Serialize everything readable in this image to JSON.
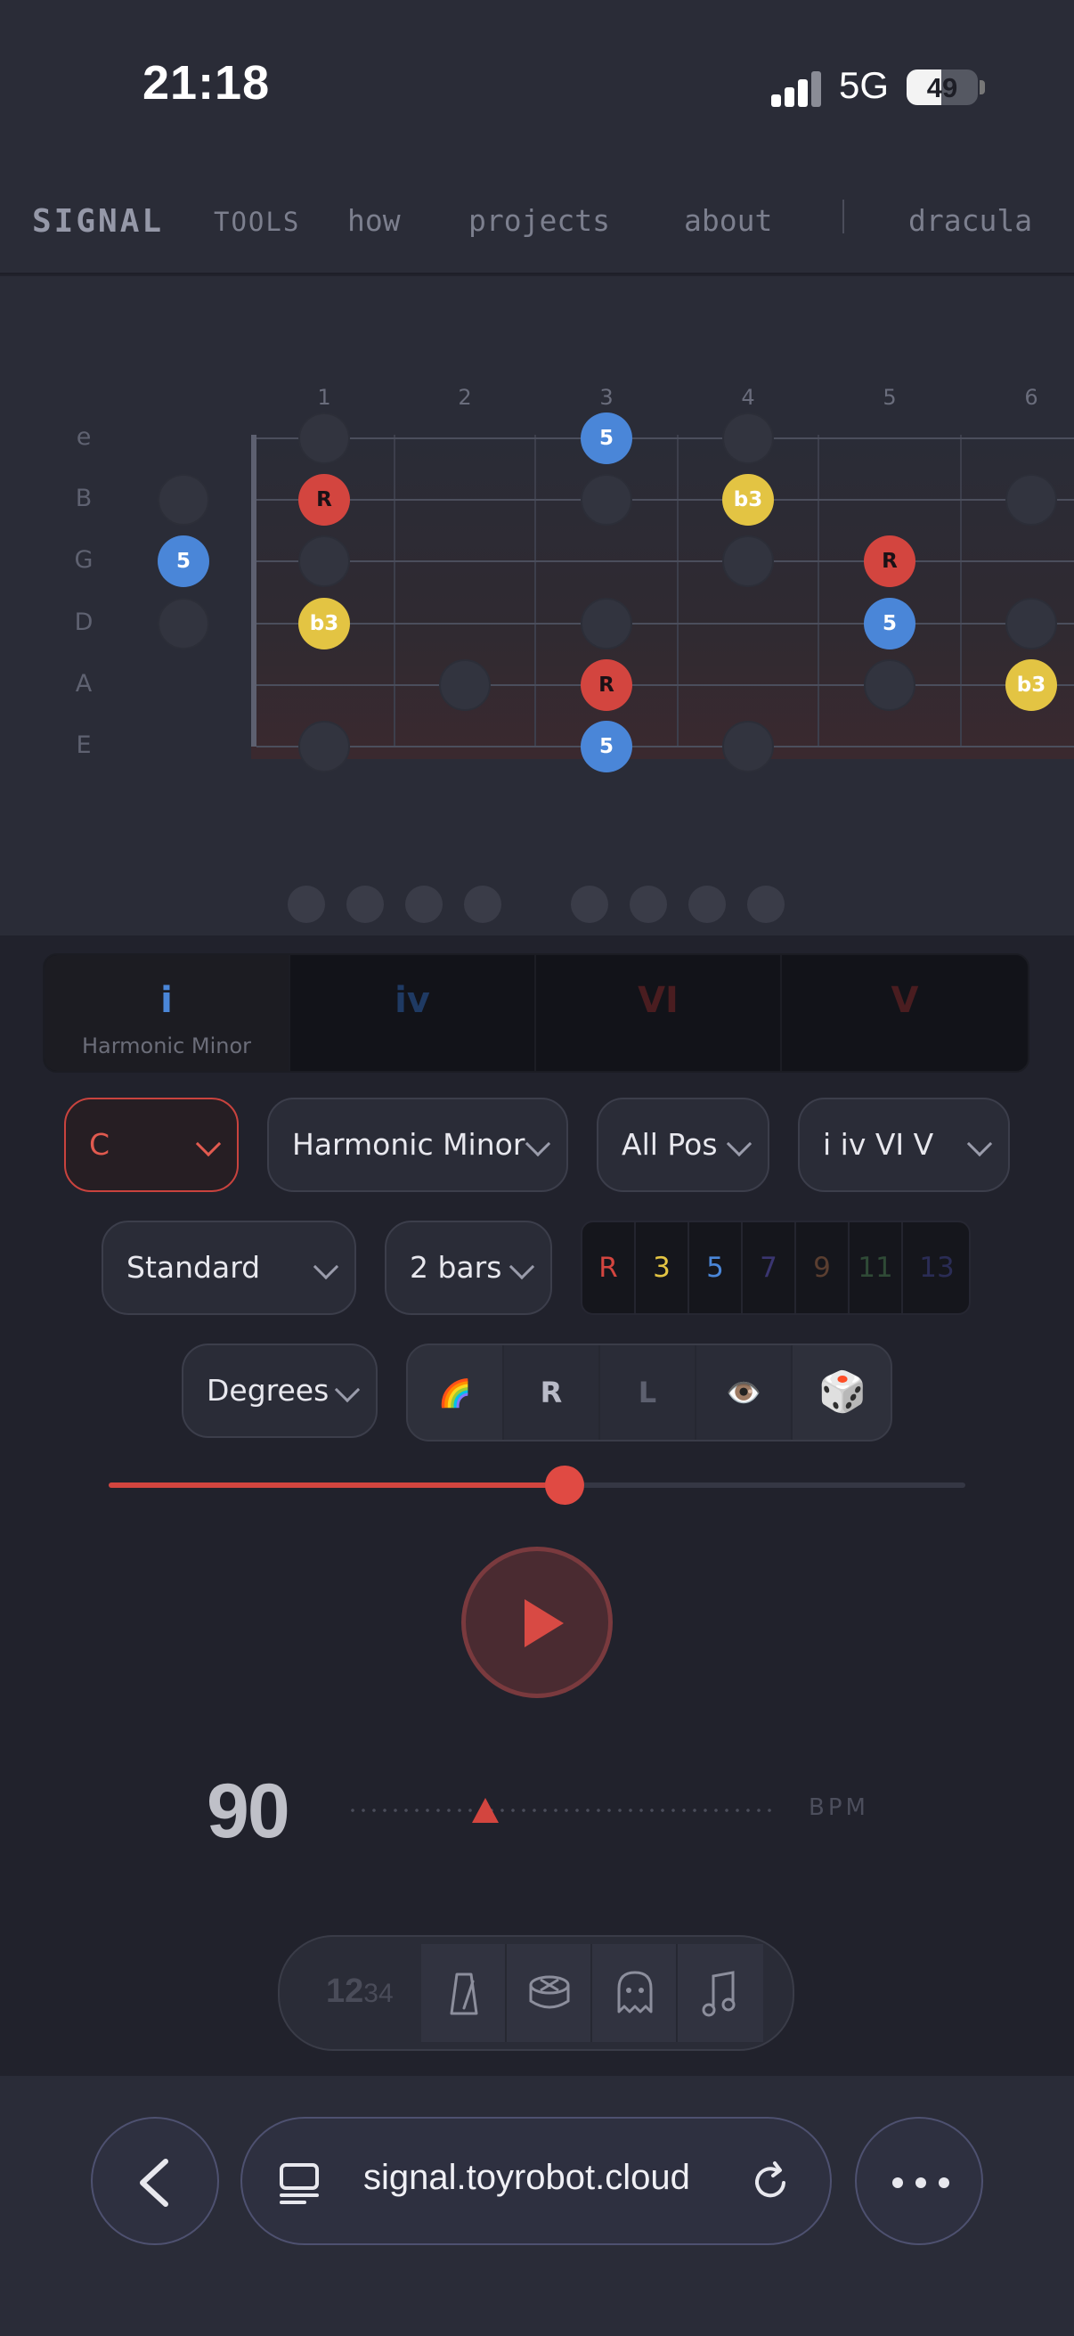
{
  "status_bar": {
    "time": "21:18",
    "network": "5G",
    "battery": "49",
    "battery_level": 0.49
  },
  "nav": {
    "brand": "SIGNAL",
    "tools": "TOOLS",
    "links": [
      "how",
      "projects",
      "about"
    ],
    "theme": "dracula"
  },
  "fretboard": {
    "fret_numbers": [
      "1",
      "2",
      "3",
      "4",
      "5",
      "6"
    ],
    "strings": [
      "e",
      "B",
      "G",
      "D",
      "A",
      "E"
    ],
    "notes": [
      {
        "string": 0,
        "fret": 3,
        "label": "5",
        "color": "blue"
      },
      {
        "string": 1,
        "fret": 1,
        "label": "R",
        "color": "red"
      },
      {
        "string": 1,
        "fret": 4,
        "label": "b3",
        "color": "yellow"
      },
      {
        "string": 2,
        "fret": 0,
        "label": "5",
        "color": "blue"
      },
      {
        "string": 2,
        "fret": 5,
        "label": "R",
        "color": "red"
      },
      {
        "string": 3,
        "fret": 1,
        "label": "b3",
        "color": "yellow"
      },
      {
        "string": 3,
        "fret": 5,
        "label": "5",
        "color": "blue"
      },
      {
        "string": 4,
        "fret": 3,
        "label": "R",
        "color": "red"
      },
      {
        "string": 4,
        "fret": 6,
        "label": "b3",
        "color": "yellow"
      },
      {
        "string": 5,
        "fret": 3,
        "label": "5",
        "color": "blue"
      }
    ],
    "empty_markers": [
      {
        "string": 0,
        "fret": 1
      },
      {
        "string": 0,
        "fret": 4
      },
      {
        "string": 1,
        "fret": 0
      },
      {
        "string": 1,
        "fret": 3
      },
      {
        "string": 1,
        "fret": 6
      },
      {
        "string": 2,
        "fret": 1
      },
      {
        "string": 2,
        "fret": 4
      },
      {
        "string": 3,
        "fret": 0
      },
      {
        "string": 3,
        "fret": 3
      },
      {
        "string": 3,
        "fret": 6
      },
      {
        "string": 4,
        "fret": 2
      },
      {
        "string": 4,
        "fret": 5
      },
      {
        "string": 5,
        "fret": 1
      },
      {
        "string": 5,
        "fret": 4
      }
    ],
    "page_count": 8
  },
  "progression": {
    "chords": [
      {
        "degree": "i",
        "name": "Harmonic Minor",
        "color": "#4a86d8",
        "active": true
      },
      {
        "degree": "iv",
        "name": "",
        "color": "#1f3a63",
        "active": false
      },
      {
        "degree": "VI",
        "name": "",
        "color": "#4a1d20",
        "active": false
      },
      {
        "degree": "V",
        "name": "",
        "color": "#4a1d20",
        "active": false
      }
    ]
  },
  "selects": {
    "key": "C",
    "scale": "Harmonic Minor",
    "position": "All Pos",
    "progression": "i iv VI V",
    "tuning": "Standard",
    "length": "2 bars",
    "labels": "Degrees"
  },
  "intervals": [
    {
      "label": "R",
      "color": "#d3453f"
    },
    {
      "label": "3",
      "color": "#e3c443"
    },
    {
      "label": "5",
      "color": "#4a86d8"
    },
    {
      "label": "7",
      "color": "#3a3570"
    },
    {
      "label": "9",
      "color": "#5a3e30"
    },
    {
      "label": "11",
      "color": "#2f4a36"
    },
    {
      "label": "13",
      "color": "#2a2c55"
    }
  ],
  "toolbox": {
    "rainbow_icon": "🌈",
    "r_label": "R",
    "l_label": "L",
    "eye_icon": "👁️",
    "dice_icon": "🎲"
  },
  "tempo": {
    "bpm": "90",
    "unit": "BPM",
    "slider_value": 0.53
  },
  "metronome": {
    "beats_big": "12",
    "beats_small": "34"
  },
  "browser": {
    "url": "signal.toyrobot.cloud"
  }
}
